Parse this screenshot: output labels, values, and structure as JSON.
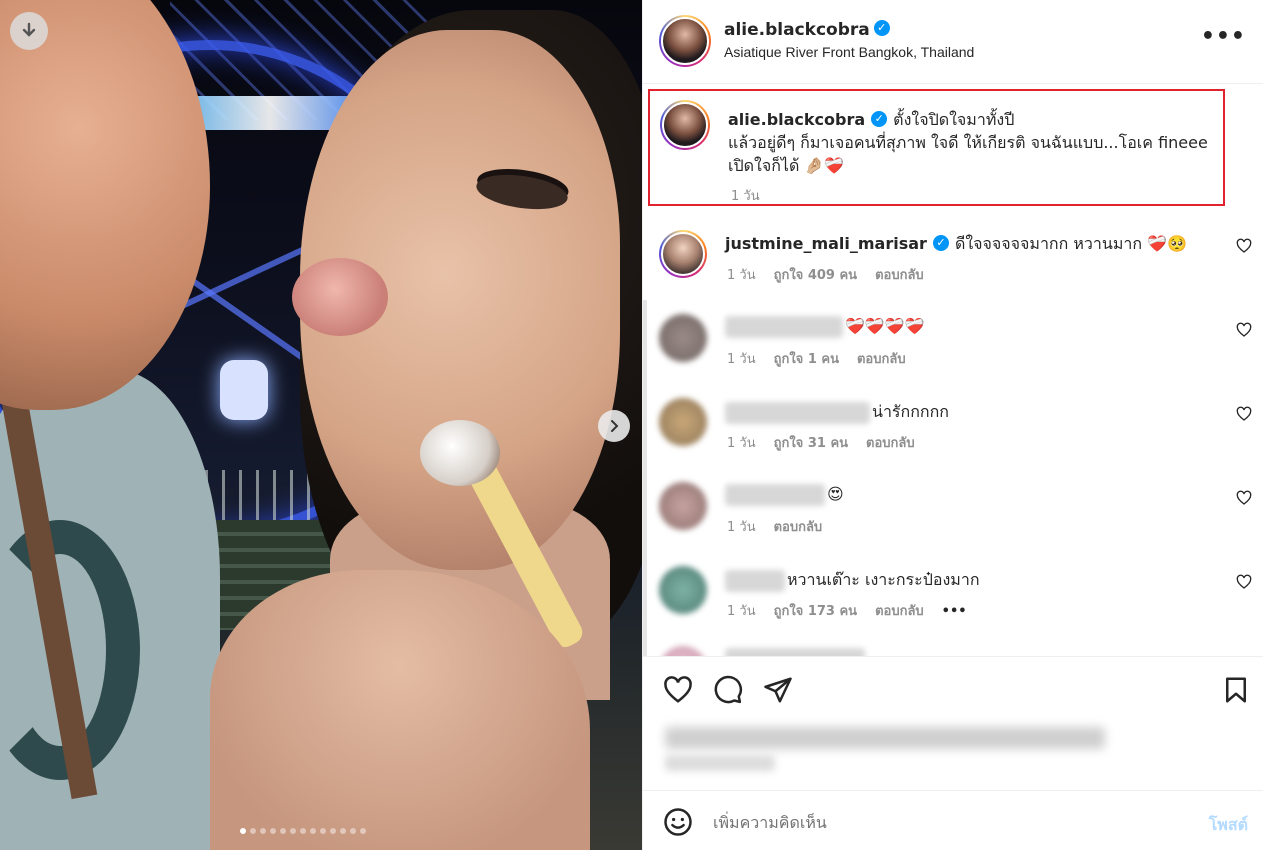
{
  "post": {
    "username": "alie.blackcobra",
    "location": "Asiatique River Front Bangkok, Thailand",
    "more_label": "•••",
    "image_dots": 13,
    "active_dot": 0
  },
  "caption": {
    "username": "alie.blackcobra",
    "line1": "ตั้งใจปิดใจมาทั้งปี",
    "line2": "แล้วอยู่ดีๆ ก็มาเจอคนที่สุภาพ ใจดี ให้เกียรติ จนฉันแบบ...โอเค fineee",
    "line3": "เปิดใจก็ได้ 🤌🏼❤️‍🩹",
    "time": "1 วัน"
  },
  "comments": [
    {
      "username": "justmine_mali_marisar",
      "text": "ดีใจจจจจจมากก หวานมาก ❤️‍🩹🥺",
      "time": "1 วัน",
      "likes": "ถูกใจ 409 คน",
      "reply": "ตอบกลับ"
    },
    {
      "username": "",
      "text": "❤️‍🩹❤️‍🩹❤️‍🩹❤️‍🩹",
      "time": "1 วัน",
      "likes": "ถูกใจ 1 คน",
      "reply": "ตอบกลับ"
    },
    {
      "username": "",
      "text": "น่ารักกกกก",
      "time": "1 วัน",
      "likes": "ถูกใจ 31 คน",
      "reply": "ตอบกลับ"
    },
    {
      "username": "",
      "text": "😍",
      "time": "1 วัน",
      "likes": "",
      "reply": "ตอบกลับ"
    },
    {
      "username": "",
      "text": "หวานเต๊าะ เงาะกระป๋องมาก",
      "time": "1 วัน",
      "likes": "ถูกใจ 173 คน",
      "reply": "ตอบกลับ",
      "more": "•••"
    }
  ],
  "composer": {
    "placeholder": "เพิ่มความคิดเห็น",
    "post_label": "โพสต์"
  },
  "icons": [
    "download-icon",
    "chevron-right-icon",
    "heart-icon",
    "comment-icon",
    "share-icon",
    "bookmark-icon",
    "emoji-icon",
    "verified-icon"
  ],
  "colors": {
    "accent": "#0095f6",
    "highlight_border": "#e0232e",
    "post_disabled": "#b3dbff"
  }
}
